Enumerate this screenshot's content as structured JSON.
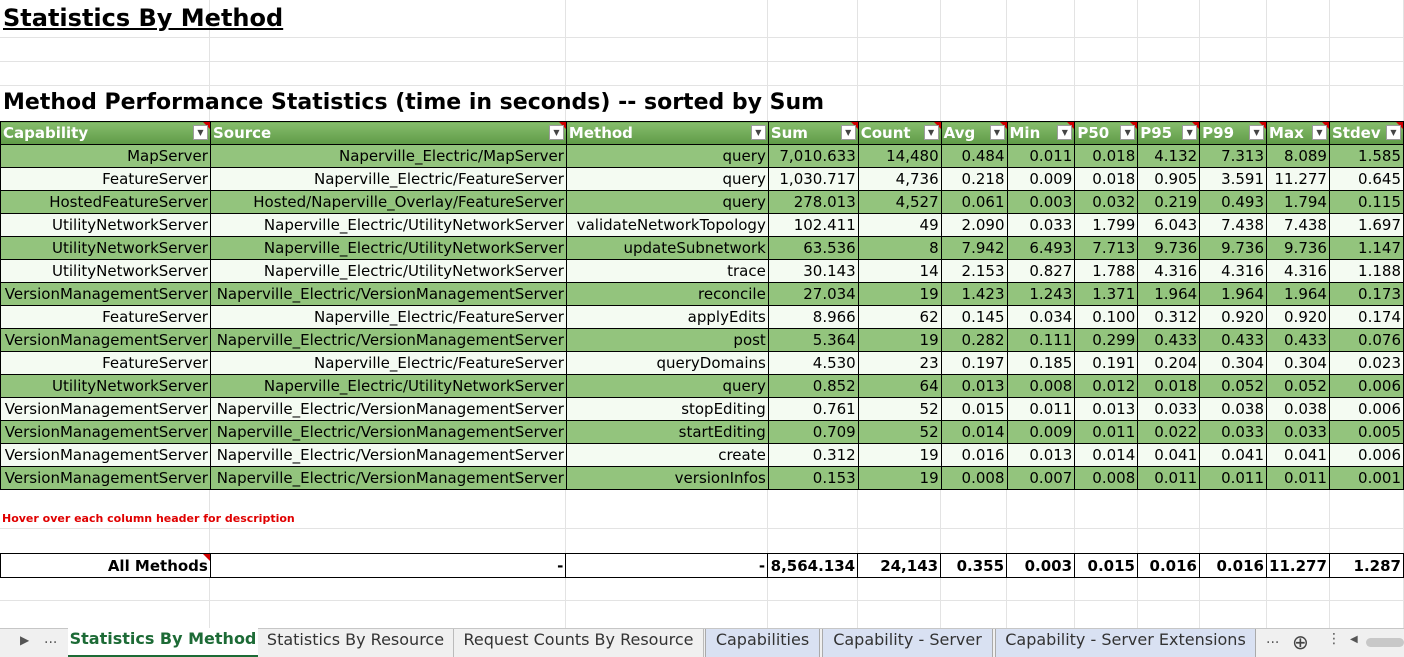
{
  "title": "Statistics By Method",
  "subtitle": "Method Performance Statistics (time in seconds) -- sorted by Sum",
  "columns": [
    "Capability",
    "Source",
    "Method",
    "Sum",
    "Count",
    "Avg",
    "Min",
    "P50",
    "P95",
    "P99",
    "Max",
    "Stdev"
  ],
  "rows": [
    [
      "MapServer",
      "Naperville_Electric/MapServer",
      "query",
      "7,010.633",
      "14,480",
      "0.484",
      "0.011",
      "0.018",
      "4.132",
      "7.313",
      "8.089",
      "1.585"
    ],
    [
      "FeatureServer",
      "Naperville_Electric/FeatureServer",
      "query",
      "1,030.717",
      "4,736",
      "0.218",
      "0.009",
      "0.018",
      "0.905",
      "3.591",
      "11.277",
      "0.645"
    ],
    [
      "HostedFeatureServer",
      "Hosted/Naperville_Overlay/FeatureServer",
      "query",
      "278.013",
      "4,527",
      "0.061",
      "0.003",
      "0.032",
      "0.219",
      "0.493",
      "1.794",
      "0.115"
    ],
    [
      "UtilityNetworkServer",
      "Naperville_Electric/UtilityNetworkServer",
      "validateNetworkTopology",
      "102.411",
      "49",
      "2.090",
      "0.033",
      "1.799",
      "6.043",
      "7.438",
      "7.438",
      "1.697"
    ],
    [
      "UtilityNetworkServer",
      "Naperville_Electric/UtilityNetworkServer",
      "updateSubnetwork",
      "63.536",
      "8",
      "7.942",
      "6.493",
      "7.713",
      "9.736",
      "9.736",
      "9.736",
      "1.147"
    ],
    [
      "UtilityNetworkServer",
      "Naperville_Electric/UtilityNetworkServer",
      "trace",
      "30.143",
      "14",
      "2.153",
      "0.827",
      "1.788",
      "4.316",
      "4.316",
      "4.316",
      "1.188"
    ],
    [
      "VersionManagementServer",
      "Naperville_Electric/VersionManagementServer",
      "reconcile",
      "27.034",
      "19",
      "1.423",
      "1.243",
      "1.371",
      "1.964",
      "1.964",
      "1.964",
      "0.173"
    ],
    [
      "FeatureServer",
      "Naperville_Electric/FeatureServer",
      "applyEdits",
      "8.966",
      "62",
      "0.145",
      "0.034",
      "0.100",
      "0.312",
      "0.920",
      "0.920",
      "0.174"
    ],
    [
      "VersionManagementServer",
      "Naperville_Electric/VersionManagementServer",
      "post",
      "5.364",
      "19",
      "0.282",
      "0.111",
      "0.299",
      "0.433",
      "0.433",
      "0.433",
      "0.076"
    ],
    [
      "FeatureServer",
      "Naperville_Electric/FeatureServer",
      "queryDomains",
      "4.530",
      "23",
      "0.197",
      "0.185",
      "0.191",
      "0.204",
      "0.304",
      "0.304",
      "0.023"
    ],
    [
      "UtilityNetworkServer",
      "Naperville_Electric/UtilityNetworkServer",
      "query",
      "0.852",
      "64",
      "0.013",
      "0.008",
      "0.012",
      "0.018",
      "0.052",
      "0.052",
      "0.006"
    ],
    [
      "VersionManagementServer",
      "Naperville_Electric/VersionManagementServer",
      "stopEditing",
      "0.761",
      "52",
      "0.015",
      "0.011",
      "0.013",
      "0.033",
      "0.038",
      "0.038",
      "0.006"
    ],
    [
      "VersionManagementServer",
      "Naperville_Electric/VersionManagementServer",
      "startEditing",
      "0.709",
      "52",
      "0.014",
      "0.009",
      "0.011",
      "0.022",
      "0.033",
      "0.033",
      "0.005"
    ],
    [
      "VersionManagementServer",
      "Naperville_Electric/VersionManagementServer",
      "create",
      "0.312",
      "19",
      "0.016",
      "0.013",
      "0.014",
      "0.041",
      "0.041",
      "0.041",
      "0.006"
    ],
    [
      "VersionManagementServer",
      "Naperville_Electric/VersionManagementServer",
      "versionInfos",
      "0.153",
      "19",
      "0.008",
      "0.007",
      "0.008",
      "0.011",
      "0.011",
      "0.011",
      "0.001"
    ]
  ],
  "note": "Hover over each column header for description",
  "totals": [
    "All Methods",
    "-",
    "-",
    "8,564.134",
    "24,143",
    "0.355",
    "0.003",
    "0.015",
    "0.016",
    "0.016",
    "11.277",
    "1.287"
  ],
  "tabs": {
    "ellipsis_left": "...",
    "t1": "Statistics By Method",
    "t2": "Statistics By Resource",
    "t3": "Request Counts By Resource",
    "t4": "Capabilities",
    "t5": "Capability - Server",
    "t6": "Capability - Server Extensions",
    "ellipsis_right": "..."
  },
  "colors": {
    "header_green": "#6aa84f",
    "row_green": "#93c47d",
    "row_light": "#f4fbf2",
    "note_red": "#e00000"
  }
}
